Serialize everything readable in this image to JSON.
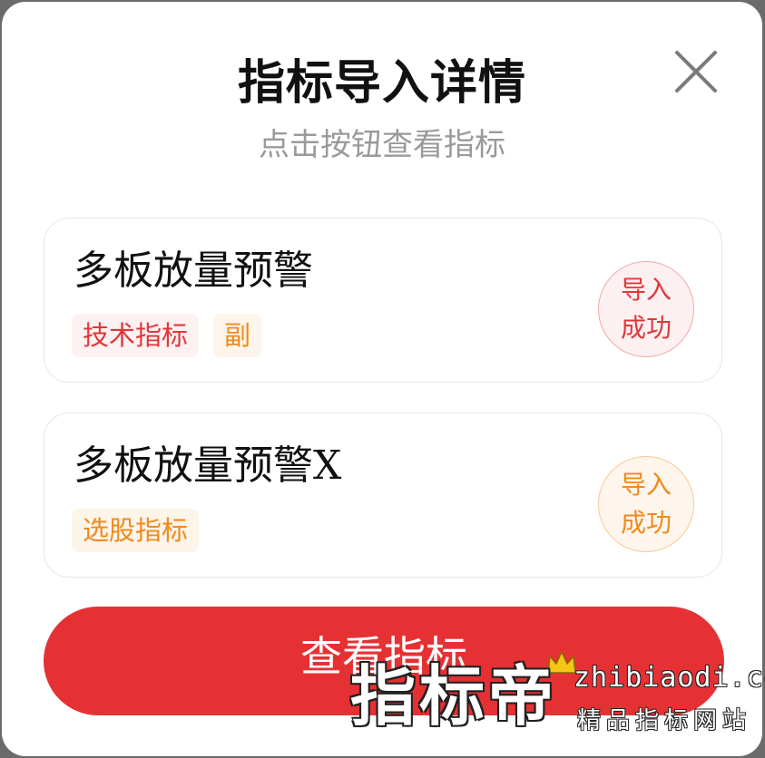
{
  "dialog": {
    "title": "指标导入详情",
    "subtitle": "点击按钮查看指标"
  },
  "items": [
    {
      "name": "多板放量预警",
      "name_suffix": "",
      "tags": [
        {
          "label": "技术指标",
          "color": "#e0383a"
        },
        {
          "label": "副",
          "color": "#f08a1c"
        }
      ],
      "status_line1": "导入",
      "status_line2": "成功",
      "status_color": "#e0383a"
    },
    {
      "name": "多板放量预警",
      "name_suffix": "X",
      "tags": [
        {
          "label": "选股指标",
          "color": "#f08a1c"
        }
      ],
      "status_line1": "导入",
      "status_line2": "成功",
      "status_color": "#f08a1c"
    }
  ],
  "view_button_label": "查看指标",
  "watermark": {
    "brand": "指标帝",
    "url": "zhibiaodi.com",
    "slogan": "精品指标网站"
  },
  "colors": {
    "accent": "#e63134"
  }
}
